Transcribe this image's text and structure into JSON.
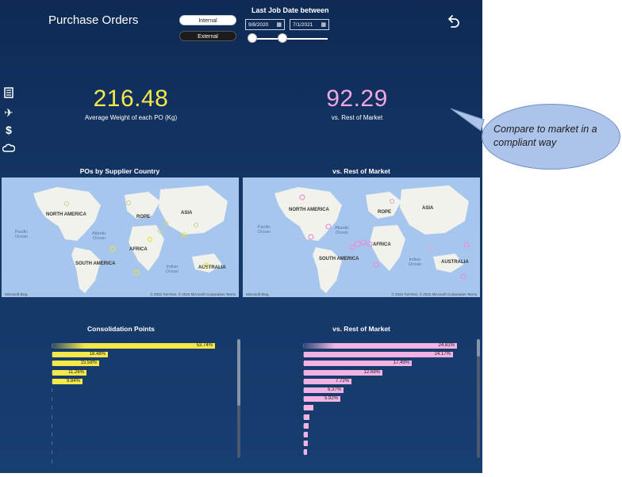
{
  "header": {
    "title": "Purchase Orders",
    "toggle": {
      "internal": "Internal",
      "external": "External"
    },
    "date_filter": {
      "label": "Last Job Date between",
      "start": "9/8/2020",
      "end": "7/1/2021"
    },
    "undo_icon": "undo-arrow-icon"
  },
  "kpis": {
    "left": {
      "value": "216.48",
      "label": "Average Weight of each PO (Kg)",
      "color": "#f7e84a"
    },
    "right": {
      "value": "92.29",
      "label": "vs. Rest of Market",
      "color": "#f2a6e2"
    }
  },
  "sidebar": {
    "icons": [
      "document-icon",
      "airplane-icon",
      "dollar-icon",
      "cloud-icon"
    ]
  },
  "maps": {
    "left": {
      "title": "POs by Supplier Country",
      "marker_color": "#e8e34a"
    },
    "right": {
      "title": "vs. Rest of Market",
      "marker_color": "#e98fd5"
    },
    "labels": {
      "north_america": "NORTH AMERICA",
      "south_america": "SOUTH AMERICA",
      "africa": "AFRICA",
      "asia": "ASIA",
      "europe": "ROPE",
      "australia": "AUSTRALIA",
      "pacific": "Pacific Ocean",
      "atlantic": "Atlantic Ocean",
      "indian": "Indian Ocean"
    },
    "brand": "Microsoft Bing",
    "copyright": "© 2022 TomTom, © 2022 Microsoft Corporation  Terms"
  },
  "charts": {
    "left": {
      "title": "Consolidation Points",
      "color": "#f7e84a",
      "values": [
        53.74,
        18.48,
        15.58,
        11.26,
        9.84,
        0,
        0,
        0,
        0,
        0,
        0,
        0,
        0,
        0
      ],
      "labels": [
        "53.74%",
        "18.48%",
        "15.58%",
        "11.26%",
        "9.84%"
      ]
    },
    "right": {
      "title": "vs. Rest of Market",
      "color": "#f2b3e4",
      "values": [
        24.81,
        24.17,
        17.49,
        12.69,
        7.72,
        6.37,
        5.92,
        1.6,
        0.9,
        0.8,
        0.7,
        0.6,
        0.5
      ],
      "labels": [
        "24.81%",
        "24.17%",
        "17.49%",
        "12.69%",
        "7.72%",
        "6.37%",
        "5.92%"
      ]
    }
  },
  "callout": {
    "text": "Compare to  market in a compliant way"
  }
}
